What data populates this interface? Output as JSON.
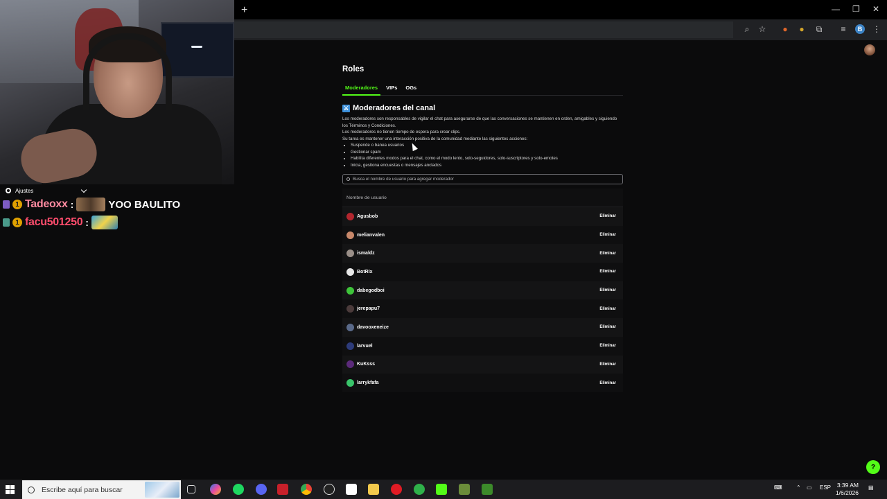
{
  "chat": {
    "settings_label": "Ajustes",
    "messages": [
      {
        "user": "Tadeoxx",
        "badge": "1",
        "text": "YOO BAULITO"
      },
      {
        "user": "facu501250",
        "badge": "1",
        "text": ""
      }
    ]
  },
  "roles": {
    "title": "Roles",
    "tabs": [
      "Moderadores",
      "VIPs",
      "OGs"
    ],
    "section_title": "Moderadores del canal",
    "desc_lines": [
      "Los moderadores son responsables de vigilar el chat para asegurarse de que las conversaciones se mantienen en orden, amigables y siguiendo los Términos y Condiciones.",
      "Los moderadores no tienen tiempo de espera para crear clips.",
      "Su tarea es mantener una interacción positiva de la comunidad mediante las siguientes acciones:"
    ],
    "bullets": [
      "Suspende o banea usuarios",
      "Gestionar spam",
      "Habilita diferentes modos para el chat, como el modo lento, solo-seguidores, solo-suscriptores y solo-emotes",
      "Inicia, gestiona encuestas o mensajes anclados"
    ],
    "search_placeholder": "Busca el nombre de usuario para agregar moderador",
    "column_header": "Nombre de usuario",
    "remove_label": "Eliminar",
    "moderators": [
      {
        "name": "Agusbob",
        "avatar_color": "#b3262e"
      },
      {
        "name": "melianvalen",
        "avatar_color": "#c8886a"
      },
      {
        "name": "ismaldz",
        "avatar_color": "#9a8f88"
      },
      {
        "name": "BotRix",
        "avatar_color": "#e8e8e8"
      },
      {
        "name": "dabegodboi",
        "avatar_color": "#3ec43a"
      },
      {
        "name": "jerepapu7",
        "avatar_color": "#4b3b3b"
      },
      {
        "name": "davooxeneize",
        "avatar_color": "#5a6a8a"
      },
      {
        "name": "larvuel",
        "avatar_color": "#2d3b7a"
      },
      {
        "name": "KuKsss",
        "avatar_color": "#5b2a7a"
      },
      {
        "name": "larrykfafa",
        "avatar_color": "#39c46a"
      }
    ]
  },
  "taskbar": {
    "search_placeholder": "Escribe aquí para buscar",
    "language": "ESP",
    "time": "3:39 AM",
    "date": "1/6/2026"
  },
  "colors": {
    "accent": "#53fc18",
    "background": "#0b0b0c"
  }
}
